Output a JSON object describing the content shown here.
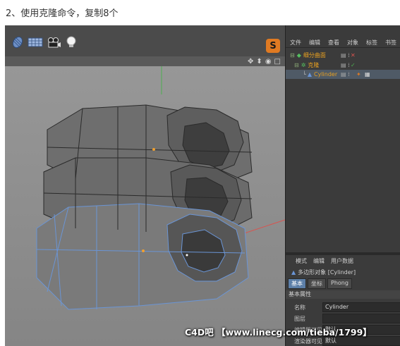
{
  "caption": "2、使用克隆命令，复制8个",
  "viewport": {
    "toolbar_icons": [
      "cube-icon",
      "plane-grid-icon",
      "camera-icon",
      "light-bulb-icon"
    ],
    "nav_icons": [
      "✥",
      "⬍",
      "◉",
      "□"
    ]
  },
  "object_manager": {
    "menu": [
      "文件",
      "编辑",
      "查看",
      "对象",
      "标签",
      "书签"
    ],
    "objects": [
      {
        "name": "细分曲面",
        "color": "#e8a020",
        "indent": 0
      },
      {
        "name": "克隆",
        "color": "#e8a020",
        "indent": 1
      },
      {
        "name": "Cylinder",
        "color": "#e8a020",
        "indent": 2
      }
    ]
  },
  "attribute_manager": {
    "menu": [
      "模式",
      "编辑",
      "用户数据"
    ],
    "title": "多边形对象 [Cylinder]",
    "tabs": [
      "基本",
      "坐标",
      "Phong"
    ],
    "section": "基本属性",
    "fields": [
      {
        "label": "名称",
        "value": "Cylinder"
      },
      {
        "label": "图层",
        "value": ""
      },
      {
        "label": "编辑器可见",
        "value": "默认"
      },
      {
        "label": "渲染器可见",
        "value": "默认"
      }
    ]
  },
  "watermark": "C4D吧 【www.linecg.com/tieba/1799】",
  "colors": {
    "accent_orange": "#e07a22",
    "selection_blue": "#6a95d6",
    "axis_green": "#4caf50",
    "axis_red": "#d9534f"
  }
}
